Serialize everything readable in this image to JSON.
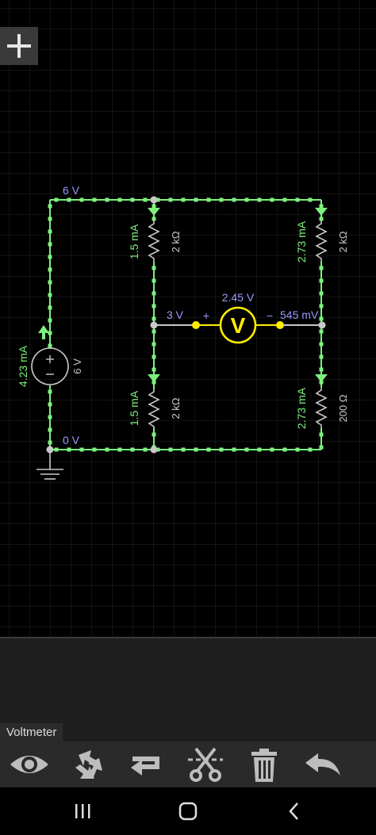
{
  "toolbar": {
    "add_icon": "plus-icon",
    "selected_component": "Voltmeter",
    "tools": [
      "eye-icon",
      "rotate-icon",
      "flip-icon",
      "cut-icon",
      "trash-icon",
      "undo-icon"
    ]
  },
  "circuit": {
    "node_top_voltage": "6 V",
    "node_bottom_voltage": "0 V",
    "node_mid_voltage": "3 V",
    "source": {
      "current": "4.23 mA",
      "voltage": "6 V"
    },
    "r_top_left": {
      "current": "1.5 mA",
      "value": "2 kΩ"
    },
    "r_bottom_left": {
      "current": "1.5 mA",
      "value": "2 kΩ"
    },
    "r_top_right": {
      "current": "2.73 mA",
      "value": "2 kΩ"
    },
    "r_bottom_right": {
      "current": "2.73 mA",
      "value": "200 Ω"
    },
    "voltmeter": {
      "reading": "2.45 V",
      "symbol": "V",
      "plus": "+",
      "minus": "−",
      "node_voltage": "545 mV"
    }
  },
  "colors": {
    "wire_green": "#7ef07e",
    "text_blue": "#9a9aff",
    "voltmeter_yellow": "#ffee00",
    "wire_grey": "#c8c8c8"
  },
  "navbar": [
    "recent-apps-icon",
    "home-icon",
    "back-icon"
  ]
}
